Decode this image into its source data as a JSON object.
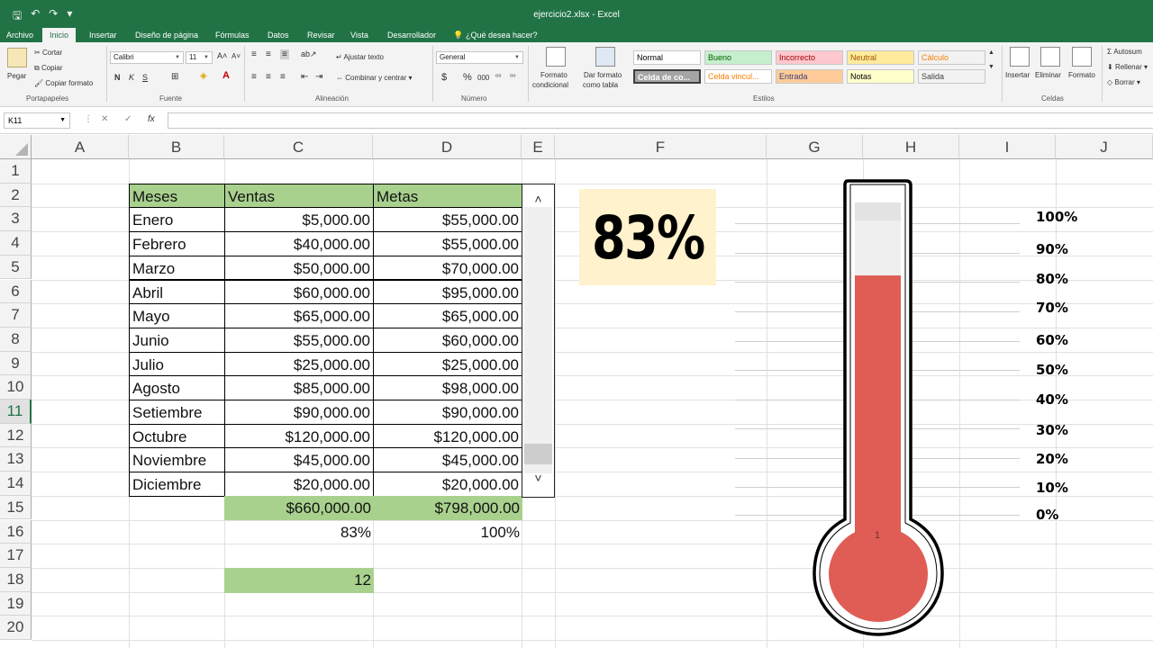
{
  "app": {
    "doc_title": "ejercicio2.xlsx - Excel",
    "qat": [
      "save-icon",
      "undo-icon",
      "redo-icon",
      "customize-icon"
    ]
  },
  "tabs": [
    "Archivo",
    "Inicio",
    "Insertar",
    "Diseño de página",
    "Fórmulas",
    "Datos",
    "Revisar",
    "Vista",
    "Desarrollador",
    "¿Qué desea hacer?"
  ],
  "ribbon": {
    "clipboard": {
      "paste": "Pegar",
      "cut": "Cortar",
      "copy": "Copiar",
      "format_painter": "Copiar formato",
      "group": "Portapapeles"
    },
    "font": {
      "name": "Calibri",
      "size": "11",
      "group": "Fuente",
      "bold": "N",
      "italic": "K",
      "underline": "S"
    },
    "alignment": {
      "wrap": "Ajustar texto",
      "merge": "Combinar y centrar",
      "group": "Alineación"
    },
    "number": {
      "format": "General",
      "currency": "$",
      "percent": "%",
      "thousands": "000",
      "group": "Número"
    },
    "styles": {
      "cond_format": [
        "Formato",
        "condicional"
      ],
      "as_table": [
        "Dar formato",
        "como tabla"
      ],
      "cells": [
        {
          "label": "Normal",
          "bg": "#ffffff",
          "fg": "#000000"
        },
        {
          "label": "Bueno",
          "bg": "#c6efce",
          "fg": "#006100"
        },
        {
          "label": "Incorrecto",
          "bg": "#ffc7ce",
          "fg": "#9c0006"
        },
        {
          "label": "Neutral",
          "bg": "#ffeb9c",
          "fg": "#9c5700"
        },
        {
          "label": "Cálculo",
          "bg": "#f2f2f2",
          "fg": "#fa7d00"
        },
        {
          "label": "Celda de co...",
          "bg": "#a5a5a5",
          "fg": "#ffffff"
        },
        {
          "label": "Celda vincul...",
          "bg": "#ffffff",
          "fg": "#fa7d00"
        },
        {
          "label": "Entrada",
          "bg": "#ffcc99",
          "fg": "#3f3f76"
        },
        {
          "label": "Notas",
          "bg": "#ffffcc",
          "fg": "#000000"
        },
        {
          "label": "Salida",
          "bg": "#f2f2f2",
          "fg": "#3f3f3f"
        }
      ],
      "group": "Estilos"
    },
    "cells": {
      "insert": "Insertar",
      "delete": "Eliminar",
      "format": "Formato",
      "group": "Celdas"
    },
    "editing": {
      "autosum": "Autosum",
      "fill": "Rellenar",
      "clear": "Borrar"
    }
  },
  "formula_bar": {
    "name_box": "K11",
    "cancel": "✕",
    "enter": "✓",
    "fx": "fx",
    "formula": ""
  },
  "columns": [
    "A",
    "B",
    "C",
    "D",
    "E",
    "F",
    "G",
    "H",
    "I",
    "J"
  ],
  "rows": [
    "1",
    "2",
    "3",
    "4",
    "5",
    "6",
    "7",
    "8",
    "9",
    "10",
    "11",
    "12",
    "13",
    "14",
    "15",
    "16",
    "17",
    "18",
    "19",
    "20"
  ],
  "selected_row": "11",
  "table": {
    "headers": [
      "Meses",
      "Ventas",
      "Metas"
    ],
    "rows": [
      [
        "Enero",
        "$5,000.00",
        "$55,000.00"
      ],
      [
        "Febrero",
        "$40,000.00",
        "$55,000.00"
      ],
      [
        "Marzo",
        "$50,000.00",
        "$70,000.00"
      ],
      [
        "Abril",
        "$60,000.00",
        "$95,000.00"
      ],
      [
        "Mayo",
        "$65,000.00",
        "$65,000.00"
      ],
      [
        "Junio",
        "$55,000.00",
        "$60,000.00"
      ],
      [
        "Julio",
        "$25,000.00",
        "$25,000.00"
      ],
      [
        "Agosto",
        "$85,000.00",
        "$98,000.00"
      ],
      [
        "Setiembre",
        "$90,000.00",
        "$90,000.00"
      ],
      [
        "Octubre",
        "$120,000.00",
        "$120,000.00"
      ],
      [
        "Noviembre",
        "$45,000.00",
        "$45,000.00"
      ],
      [
        "Diciembre",
        "$20,000.00",
        "$20,000.00"
      ]
    ],
    "total_ventas": "$660,000.00",
    "total_metas": "$798,000.00",
    "pct_ventas": "83%",
    "pct_metas": "100%",
    "scroll_value": "12"
  },
  "scrollbar": {
    "value": 12,
    "max": 12
  },
  "percent_display": "83%",
  "thermometer": {
    "fill_fraction": 0.83,
    "bulb_label": "1",
    "scale_labels": [
      "100%",
      "90%",
      "80%",
      "70%",
      "60%",
      "50%",
      "40%",
      "30%",
      "20%",
      "10%",
      "0%"
    ],
    "fill_color": "#df5d55",
    "empty_color": "#efefef"
  }
}
